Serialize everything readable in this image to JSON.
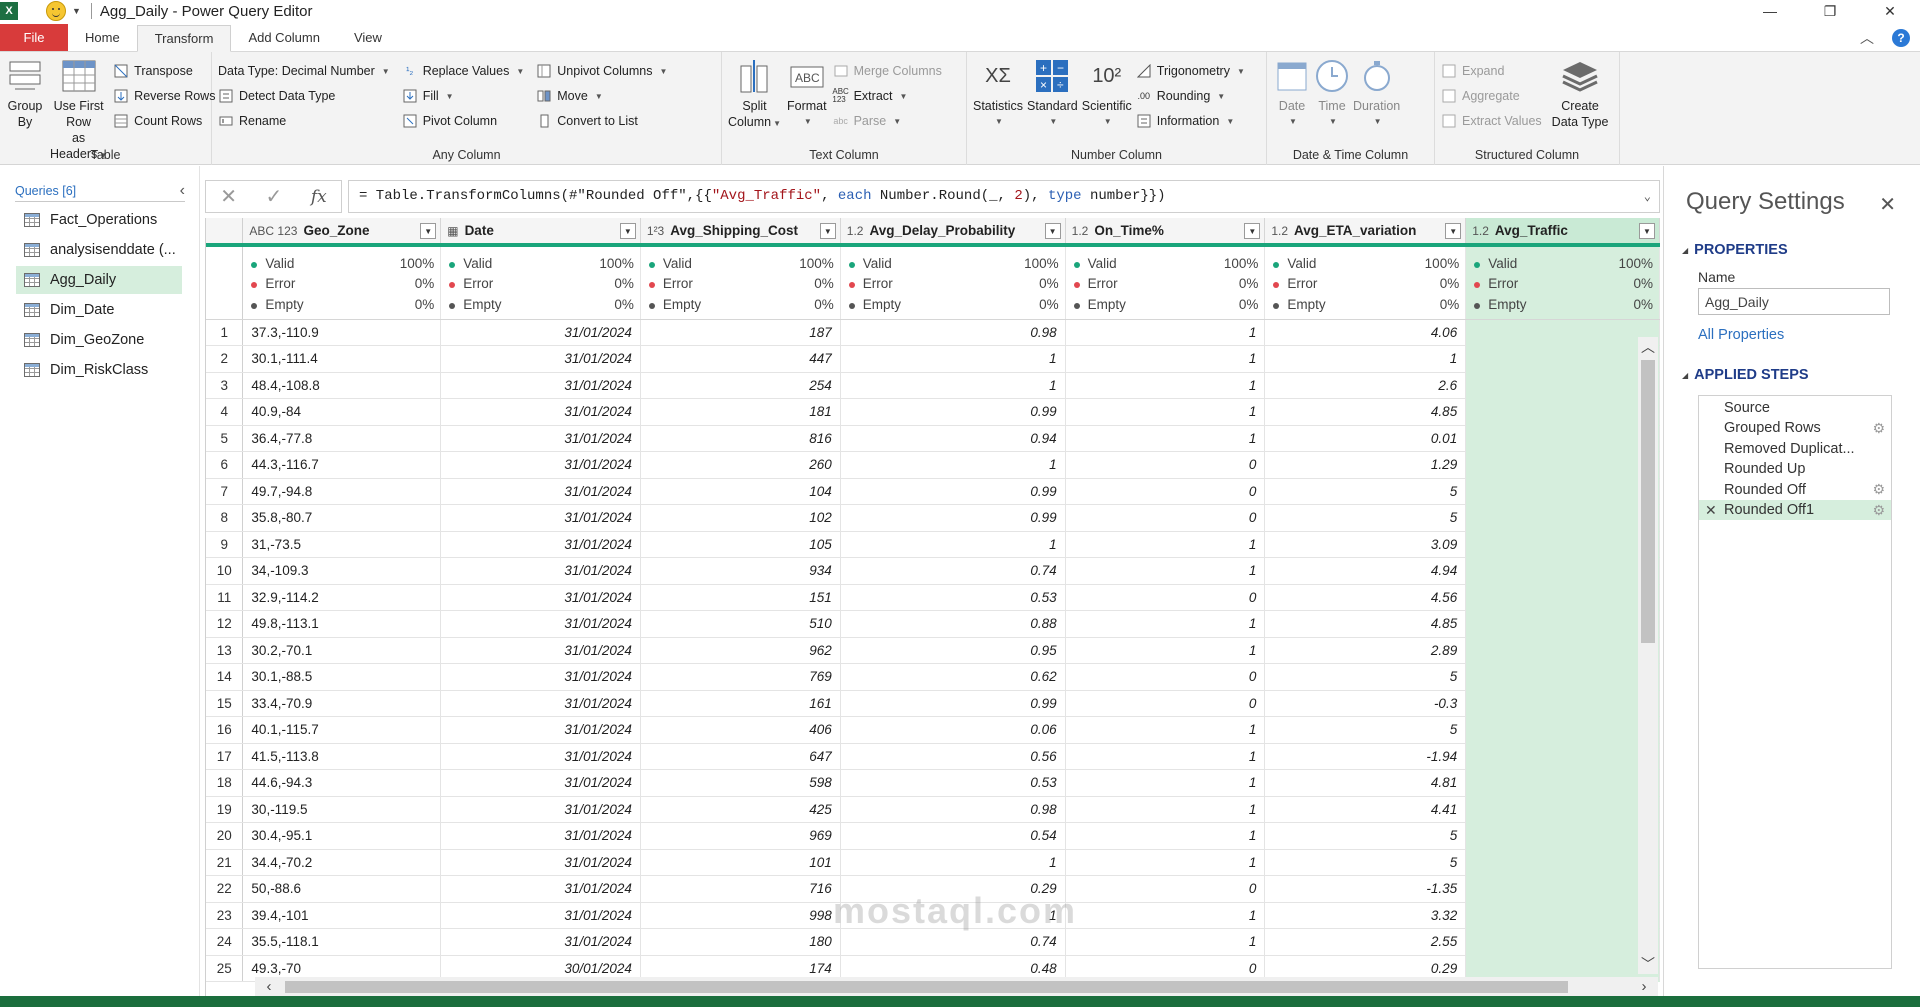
{
  "window": {
    "title": "Agg_Daily - Power Query Editor",
    "minimize": "—",
    "restore": "❐",
    "close": "✕"
  },
  "tabs": [
    "File",
    "Home",
    "Transform",
    "Add Column",
    "View"
  ],
  "active_tab": "Transform",
  "ribbon": {
    "table": {
      "label": "Table",
      "group_by": [
        "Group",
        "By"
      ],
      "use_first_row": [
        "Use First Row",
        "as Headers"
      ],
      "transpose": "Transpose",
      "reverse_rows": "Reverse Rows",
      "count_rows": "Count Rows"
    },
    "any_column": {
      "label": "Any Column",
      "data_type": "Data Type: Decimal Number",
      "detect_data_type": "Detect Data Type",
      "rename": "Rename",
      "replace_values": "Replace Values",
      "fill": "Fill",
      "pivot_column": "Pivot Column",
      "unpivot_columns": "Unpivot Columns",
      "move": "Move",
      "convert_to_list": "Convert to List"
    },
    "text_column": {
      "label": "Text Column",
      "split_column": [
        "Split",
        "Column"
      ],
      "format": "Format",
      "merge_columns": "Merge Columns",
      "extract": "Extract",
      "parse": "Parse"
    },
    "number_column": {
      "label": "Number Column",
      "statistics": "Statistics",
      "standard": "Standard",
      "scientific": "Scientific",
      "trigonometry": "Trigonometry",
      "rounding": "Rounding",
      "information": "Information"
    },
    "datetime_column": {
      "label": "Date & Time Column",
      "date": "Date",
      "time": "Time",
      "duration": "Duration"
    },
    "structured_column": {
      "label": "Structured Column",
      "expand": "Expand",
      "aggregate": "Aggregate",
      "extract_values": "Extract Values",
      "create_data_type": [
        "Create",
        "Data Type"
      ]
    }
  },
  "queries": {
    "header": "Queries [6]",
    "items": [
      "Fact_Operations",
      "analysisenddate (...",
      "Agg_Daily",
      "Dim_Date",
      "Dim_GeoZone",
      "Dim_RiskClass"
    ],
    "selected": "Agg_Daily"
  },
  "formula": {
    "cancel": "✕",
    "commit": "✓",
    "fx": "fx",
    "parts": [
      "= Table.TransformColumns(#\"Rounded Off\",{{",
      "\"Avg_Traffic\"",
      ", ",
      "each",
      " Number.Round(_, ",
      "2",
      "), ",
      "type",
      " number}})"
    ]
  },
  "grid": {
    "columns": [
      {
        "type": "ABC 123",
        "name": "Geo_Zone"
      },
      {
        "type": "▦",
        "name": "Date"
      },
      {
        "type": "1²3",
        "name": "Avg_Shipping_Cost"
      },
      {
        "type": "1.2",
        "name": "Avg_Delay_Probability"
      },
      {
        "type": "1.2",
        "name": "On_Time%"
      },
      {
        "type": "1.2",
        "name": "Avg_ETA_variation"
      },
      {
        "type": "1.2",
        "name": "Avg_Traffic"
      }
    ],
    "quality": {
      "valid": "Valid",
      "error": "Error",
      "empty": "Empty",
      "valid_pct": "100%",
      "error_pct": "0%",
      "empty_pct": "0%"
    },
    "rows": [
      [
        "37.3,-110.9",
        "31/01/2024",
        "187",
        "0.98",
        "1",
        "4.06"
      ],
      [
        "30.1,-111.4",
        "31/01/2024",
        "447",
        "1",
        "1",
        "1"
      ],
      [
        "48.4,-108.8",
        "31/01/2024",
        "254",
        "1",
        "1",
        "2.6"
      ],
      [
        "40.9,-84",
        "31/01/2024",
        "181",
        "0.99",
        "1",
        "4.85"
      ],
      [
        "36.4,-77.8",
        "31/01/2024",
        "816",
        "0.94",
        "1",
        "0.01"
      ],
      [
        "44.3,-116.7",
        "31/01/2024",
        "260",
        "1",
        "0",
        "1.29"
      ],
      [
        "49.7,-94.8",
        "31/01/2024",
        "104",
        "0.99",
        "0",
        "5"
      ],
      [
        "35.8,-80.7",
        "31/01/2024",
        "102",
        "0.99",
        "0",
        "5"
      ],
      [
        "31,-73.5",
        "31/01/2024",
        "105",
        "1",
        "1",
        "3.09"
      ],
      [
        "34,-109.3",
        "31/01/2024",
        "934",
        "0.74",
        "1",
        "4.94"
      ],
      [
        "32.9,-114.2",
        "31/01/2024",
        "151",
        "0.53",
        "0",
        "4.56"
      ],
      [
        "49.8,-113.1",
        "31/01/2024",
        "510",
        "0.88",
        "1",
        "4.85"
      ],
      [
        "30.2,-70.1",
        "31/01/2024",
        "962",
        "0.95",
        "1",
        "2.89"
      ],
      [
        "30.1,-88.5",
        "31/01/2024",
        "769",
        "0.62",
        "0",
        "5"
      ],
      [
        "33.4,-70.9",
        "31/01/2024",
        "161",
        "0.99",
        "0",
        "-0.3"
      ],
      [
        "40.1,-115.7",
        "31/01/2024",
        "406",
        "0.06",
        "1",
        "5"
      ],
      [
        "41.5,-113.8",
        "31/01/2024",
        "647",
        "0.56",
        "1",
        "-1.94"
      ],
      [
        "44.6,-94.3",
        "31/01/2024",
        "598",
        "0.53",
        "1",
        "4.81"
      ],
      [
        "30,-119.5",
        "31/01/2024",
        "425",
        "0.98",
        "1",
        "4.41"
      ],
      [
        "30.4,-95.1",
        "31/01/2024",
        "969",
        "0.54",
        "1",
        "5"
      ],
      [
        "34.4,-70.2",
        "31/01/2024",
        "101",
        "1",
        "1",
        "5"
      ],
      [
        "50,-88.6",
        "31/01/2024",
        "716",
        "0.29",
        "0",
        "-1.35"
      ],
      [
        "39.4,-101",
        "31/01/2024",
        "998",
        "1",
        "1",
        "3.32"
      ],
      [
        "35.5,-118.1",
        "31/01/2024",
        "180",
        "0.74",
        "1",
        "2.55"
      ],
      [
        "49.3,-70",
        "30/01/2024",
        "174",
        "0.48",
        "0",
        "0.29"
      ]
    ]
  },
  "settings": {
    "title": "Query Settings",
    "close": "✕",
    "properties": "PROPERTIES",
    "name_label": "Name",
    "name_value": "Agg_Daily",
    "all_properties": "All Properties",
    "applied_steps": "APPLIED STEPS",
    "steps": [
      {
        "label": "Source",
        "gear": false
      },
      {
        "label": "Grouped Rows",
        "gear": true
      },
      {
        "label": "Removed Duplicat...",
        "gear": false
      },
      {
        "label": "Rounded Up",
        "gear": false
      },
      {
        "label": "Rounded Off",
        "gear": true
      },
      {
        "label": "Rounded Off1",
        "gear": true
      }
    ],
    "selected_step": "Rounded Off1"
  },
  "watermark": "mostaql.com"
}
